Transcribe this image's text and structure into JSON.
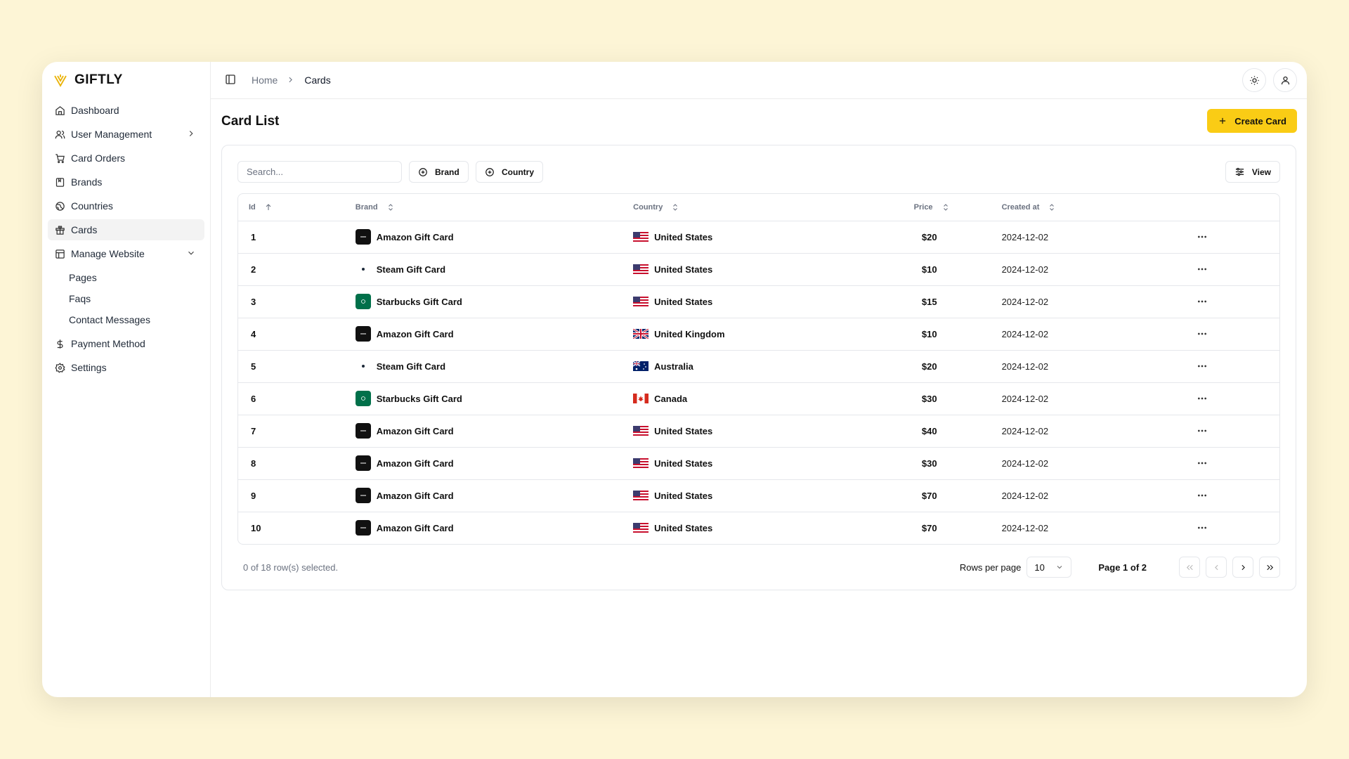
{
  "app": {
    "name": "GIFTLY",
    "accent": "#facc15",
    "background": "#fdf5d6"
  },
  "sidebar": {
    "items": [
      {
        "label": "Dashboard",
        "icon": "home-icon"
      },
      {
        "label": "User Management",
        "icon": "users-icon"
      },
      {
        "label": "Card Orders",
        "icon": "cart-icon"
      },
      {
        "label": "Brands",
        "icon": "bookmark-icon"
      },
      {
        "label": "Countries",
        "icon": "globe-icon"
      },
      {
        "label": "Cards",
        "icon": "gift-icon",
        "active": true
      },
      {
        "label": "Manage Website",
        "icon": "layout-icon",
        "expanded": true
      },
      {
        "label": "Payment Method",
        "icon": "dollar-icon"
      },
      {
        "label": "Settings",
        "icon": "gear-icon"
      }
    ],
    "sub_items": [
      "Pages",
      "Faqs",
      "Contact Messages"
    ]
  },
  "breadcrumb": {
    "home": "Home",
    "current": "Cards"
  },
  "page": {
    "title": "Card List",
    "create_label": "Create Card"
  },
  "toolbar": {
    "search_placeholder": "Search...",
    "brand_filter": "Brand",
    "country_filter": "Country",
    "view_label": "View"
  },
  "table": {
    "headers": {
      "id": "Id",
      "brand": "Brand",
      "country": "Country",
      "price": "Price",
      "created": "Created at"
    },
    "rows": [
      {
        "id": "1",
        "brand": "Amazon Gift Card",
        "brand_type": "amazon",
        "country": "United States",
        "flag": "us",
        "price": "$20",
        "created": "2024-12-02"
      },
      {
        "id": "2",
        "brand": "Steam Gift Card",
        "brand_type": "steam",
        "country": "United States",
        "flag": "us",
        "price": "$10",
        "created": "2024-12-02"
      },
      {
        "id": "3",
        "brand": "Starbucks Gift Card",
        "brand_type": "starbucks",
        "country": "United States",
        "flag": "us",
        "price": "$15",
        "created": "2024-12-02"
      },
      {
        "id": "4",
        "brand": "Amazon Gift Card",
        "brand_type": "amazon",
        "country": "United Kingdom",
        "flag": "uk",
        "price": "$10",
        "created": "2024-12-02"
      },
      {
        "id": "5",
        "brand": "Steam Gift Card",
        "brand_type": "steam",
        "country": "Australia",
        "flag": "au",
        "price": "$20",
        "created": "2024-12-02"
      },
      {
        "id": "6",
        "brand": "Starbucks Gift Card",
        "brand_type": "starbucks",
        "country": "Canada",
        "flag": "ca",
        "price": "$30",
        "created": "2024-12-02"
      },
      {
        "id": "7",
        "brand": "Amazon Gift Card",
        "brand_type": "amazon",
        "country": "United States",
        "flag": "us",
        "price": "$40",
        "created": "2024-12-02"
      },
      {
        "id": "8",
        "brand": "Amazon Gift Card",
        "brand_type": "amazon",
        "country": "United States",
        "flag": "us",
        "price": "$30",
        "created": "2024-12-02"
      },
      {
        "id": "9",
        "brand": "Amazon Gift Card",
        "brand_type": "amazon",
        "country": "United States",
        "flag": "us",
        "price": "$70",
        "created": "2024-12-02"
      },
      {
        "id": "10",
        "brand": "Amazon Gift Card",
        "brand_type": "amazon",
        "country": "United States",
        "flag": "us",
        "price": "$70",
        "created": "2024-12-02"
      }
    ]
  },
  "footer": {
    "selected": "0 of 18 row(s) selected.",
    "rows_per_page_label": "Rows per page",
    "rows_per_page": "10",
    "page_label": "Page 1 of 2"
  }
}
